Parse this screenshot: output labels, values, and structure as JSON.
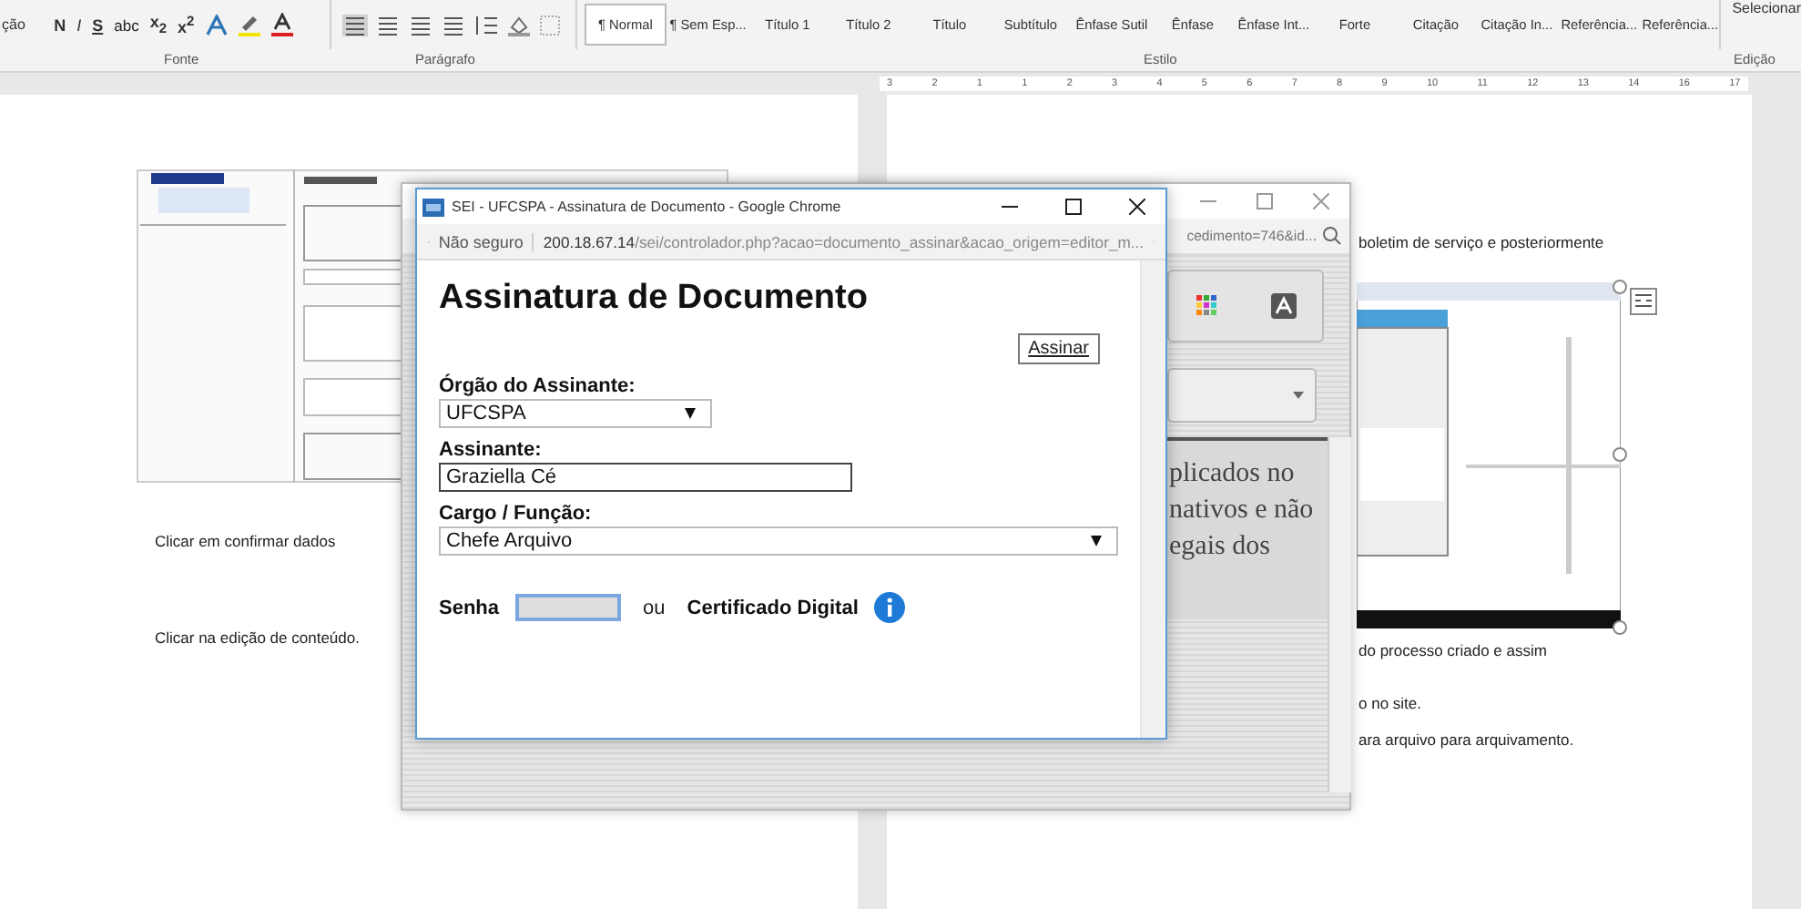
{
  "ribbon": {
    "clipped_label": "ção",
    "font_buttons": [
      "N",
      "I",
      "S",
      "abc",
      "x$_{2}$",
      "x$^{2}$"
    ],
    "styles": [
      {
        "label": "¶ Normal",
        "selected": true
      },
      {
        "label": "¶ Sem Esp...",
        "selected": false
      },
      {
        "label": "Título 1",
        "selected": false
      },
      {
        "label": "Título 2",
        "selected": false
      },
      {
        "label": "Título",
        "selected": false
      },
      {
        "label": "Subtítulo",
        "selected": false
      },
      {
        "label": "Ênfase Sutil",
        "selected": false
      },
      {
        "label": "Ênfase",
        "selected": false
      },
      {
        "label": "Ênfase Int...",
        "selected": false
      },
      {
        "label": "Forte",
        "selected": false
      },
      {
        "label": "Citação",
        "selected": false
      },
      {
        "label": "Citação In...",
        "selected": false
      },
      {
        "label": "Referência...",
        "selected": false
      },
      {
        "label": "Referência...",
        "selected": false
      }
    ],
    "groups": [
      "Fonte",
      "Parágrafo",
      "Estilo",
      "Edição"
    ],
    "edit_items": [
      "Selecionar"
    ]
  },
  "ruler": {
    "numbers": [
      "3",
      "2",
      "1",
      "1",
      "2",
      "3",
      "4",
      "5",
      "6",
      "7",
      "8",
      "9",
      "10",
      "11",
      "12",
      "13",
      "14",
      "16",
      "17"
    ]
  },
  "document": {
    "left_page": {
      "paragraphs": [
        "Clicar em confirmar dados",
        "Clicar na edição de conteúdo."
      ]
    },
    "right_page": {
      "paragraphs": [
        "boletim de serviço e posteriormente",
        "do processo criado e assim",
        "o no site.",
        "ara arquivo para arquivamento."
      ]
    }
  },
  "back_window": {
    "address": "cedimento=746&id...",
    "body_text": [
      "plicados no",
      "nativos e não",
      "egais dos"
    ]
  },
  "front_window": {
    "title": "SEI - UFCSPA - Assinatura de Documento - Google Chrome",
    "security": "Não seguro",
    "url_host": "200.18.67.14",
    "url_path": "/sei/controlador.php?acao=documento_assinar&acao_origem=editor_m...",
    "heading": "Assinatura de Documento",
    "sign_button": "Assinar",
    "fields": [
      {
        "kind": "combo",
        "label": "Órgão do Assinante:",
        "value": "UFCSPA"
      },
      {
        "kind": "text",
        "label": "Assinante:",
        "value": "Graziella Cé"
      },
      {
        "kind": "select",
        "label": "Cargo / Função:",
        "value": "Chefe Arquivo"
      }
    ],
    "password": {
      "label": "Senha",
      "separator": "ou",
      "certificate": "Certificado Digital"
    }
  }
}
